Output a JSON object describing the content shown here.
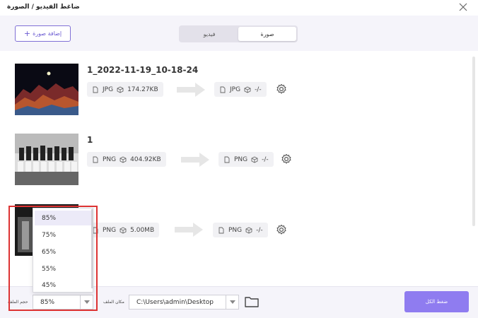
{
  "window": {
    "title": "ضاغط الفيديو / الصورة"
  },
  "header": {
    "add_image_label": "إضافة صورة",
    "tabs": [
      {
        "label": "فيديو",
        "active": false
      },
      {
        "label": "صورة",
        "active": true
      }
    ]
  },
  "files": [
    {
      "name": "1_2022-11-19_10-18-24",
      "source": {
        "format": "JPG",
        "size": "174.27KB"
      },
      "output": {
        "format": "JPG",
        "size": "-/-"
      }
    },
    {
      "name": "1",
      "source": {
        "format": "PNG",
        "size": "404.92KB"
      },
      "output": {
        "format": "PNG",
        "size": "-/-"
      }
    },
    {
      "name": "",
      "source": {
        "format": "PNG",
        "size": "5.00MB"
      },
      "output": {
        "format": "PNG",
        "size": "-/-"
      }
    }
  ],
  "quality_dropdown": {
    "options": [
      "85%",
      "75%",
      "65%",
      "55%",
      "45%"
    ],
    "selected": "85%"
  },
  "footer": {
    "file_size_label": "حجم الملف",
    "quality_value": "85%",
    "location_label": "مكان الملف",
    "location_path": "C:\\Users\\admin\\Desktop",
    "compress_all_label": "ضغط الكل"
  },
  "colors": {
    "accent": "#8f7cf0",
    "highlight": "#dd3333"
  }
}
